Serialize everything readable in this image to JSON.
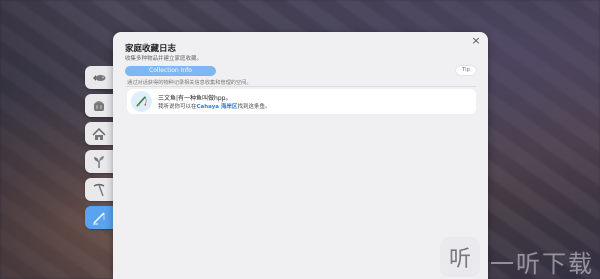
{
  "panel": {
    "title": "家庭收藏日志",
    "subtitle": "收集多种物品并建立家庭收藏。",
    "close_icon": "×",
    "tabs": {
      "main": "Collection Info",
      "tip": "Tip"
    },
    "description": "通过对话获得的物种记录相关信息收集和管理的空间。",
    "items": [
      {
        "title": "三文鱼|有一种鱼叫做hpp。",
        "line2_prefix": "我听说你可以在",
        "line2_highlight": "Cahaya 海岸区",
        "line2_suffix": "找到这条鱼。",
        "icon": "fishing-rod-icon"
      }
    ]
  },
  "side_tabs": [
    {
      "icon": "fish-icon",
      "active": false
    },
    {
      "icon": "bread-icon",
      "active": false
    },
    {
      "icon": "house-icon",
      "active": false
    },
    {
      "icon": "sprout-icon",
      "active": false
    },
    {
      "icon": "pickaxe-icon",
      "active": false
    },
    {
      "icon": "fishing-rod-icon",
      "active": true
    }
  ],
  "watermark": {
    "badge": "听",
    "text": "一听下载"
  },
  "colors": {
    "accent": "#5aa3ee",
    "highlight": "#2f7fd4",
    "panel": "#f0f0f2"
  }
}
